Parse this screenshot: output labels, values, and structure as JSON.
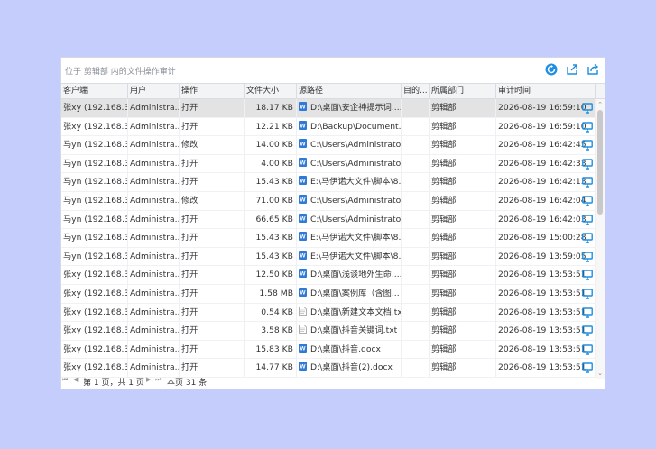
{
  "panel": {
    "title": "位于 剪辑部 内的文件操作审计",
    "icons": [
      "refresh-icon",
      "export-icon",
      "share-icon"
    ],
    "accent_color": "#1e8fe0"
  },
  "columns": [
    "客户端",
    "用户",
    "操作",
    "文件大小",
    "源路径",
    "目的...",
    "所属部门",
    "审计时间"
  ],
  "rows": [
    {
      "client": "张xy (192.168.3...",
      "user": "Administra...",
      "op": "打开",
      "size": "18.17 KB",
      "icon": "word",
      "path": "D:\\桌面\\安企神提示词....",
      "dest": "",
      "dept": "剪辑部",
      "time": "2026-08-19 16:59:10"
    },
    {
      "client": "张xy (192.168.3...",
      "user": "Administra...",
      "op": "打开",
      "size": "12.21 KB",
      "icon": "word",
      "path": "D:\\Backup\\Document...",
      "dest": "",
      "dept": "剪辑部",
      "time": "2026-08-19 16:59:10"
    },
    {
      "client": "马yn (192.168.3...",
      "user": "Administra...",
      "op": "修改",
      "size": "14.00 KB",
      "icon": "word",
      "path": "C:\\Users\\Administrato...",
      "dest": "",
      "dept": "剪辑部",
      "time": "2026-08-19 16:42:45"
    },
    {
      "client": "马yn (192.168.3...",
      "user": "Administra...",
      "op": "打开",
      "size": "4.00 KB",
      "icon": "word",
      "path": "C:\\Users\\Administrato...",
      "dest": "",
      "dept": "剪辑部",
      "time": "2026-08-19 16:42:33"
    },
    {
      "client": "马yn (192.168.3...",
      "user": "Administra...",
      "op": "打开",
      "size": "15.43 KB",
      "icon": "word",
      "path": "E:\\马伊诺大文件\\脚本\\8...",
      "dest": "",
      "dept": "剪辑部",
      "time": "2026-08-19 16:42:13"
    },
    {
      "client": "马yn (192.168.3...",
      "user": "Administra...",
      "op": "修改",
      "size": "71.00 KB",
      "icon": "word",
      "path": "C:\\Users\\Administrato...",
      "dest": "",
      "dept": "剪辑部",
      "time": "2026-08-19 16:42:04"
    },
    {
      "client": "马yn (192.168.3...",
      "user": "Administra...",
      "op": "打开",
      "size": "66.65 KB",
      "icon": "word",
      "path": "C:\\Users\\Administrato...",
      "dest": "",
      "dept": "剪辑部",
      "time": "2026-08-19 16:42:03"
    },
    {
      "client": "马yn (192.168.3...",
      "user": "Administra...",
      "op": "打开",
      "size": "15.43 KB",
      "icon": "word",
      "path": "E:\\马伊诺大文件\\脚本\\8...",
      "dest": "",
      "dept": "剪辑部",
      "time": "2026-08-19 15:00:28"
    },
    {
      "client": "马yn (192.168.3...",
      "user": "Administra...",
      "op": "打开",
      "size": "15.43 KB",
      "icon": "word",
      "path": "E:\\马伊诺大文件\\脚本\\8...",
      "dest": "",
      "dept": "剪辑部",
      "time": "2026-08-19 13:59:05"
    },
    {
      "client": "张xy (192.168.3...",
      "user": "Administra...",
      "op": "打开",
      "size": "12.50 KB",
      "icon": "word",
      "path": "D:\\桌面\\浅谈地外生命....",
      "dest": "",
      "dept": "剪辑部",
      "time": "2026-08-19 13:53:51"
    },
    {
      "client": "张xy (192.168.3...",
      "user": "Administra...",
      "op": "打开",
      "size": "1.58 MB",
      "icon": "word",
      "path": "D:\\桌面\\案例库（含图...",
      "dest": "",
      "dept": "剪辑部",
      "time": "2026-08-19 13:53:51"
    },
    {
      "client": "张xy (192.168.3...",
      "user": "Administra...",
      "op": "打开",
      "size": "0.54 KB",
      "icon": "txt",
      "path": "D:\\桌面\\新建文本文档.txt",
      "dest": "",
      "dept": "剪辑部",
      "time": "2026-08-19 13:53:51"
    },
    {
      "client": "张xy (192.168.3...",
      "user": "Administra...",
      "op": "打开",
      "size": "3.58 KB",
      "icon": "txt",
      "path": "D:\\桌面\\抖音关键词.txt",
      "dest": "",
      "dept": "剪辑部",
      "time": "2026-08-19 13:53:51"
    },
    {
      "client": "张xy (192.168.3...",
      "user": "Administra...",
      "op": "打开",
      "size": "15.83 KB",
      "icon": "word",
      "path": "D:\\桌面\\抖音.docx",
      "dest": "",
      "dept": "剪辑部",
      "time": "2026-08-19 13:53:51"
    },
    {
      "client": "张xy (192.168.3...",
      "user": "Administra...",
      "op": "打开",
      "size": "14.77 KB",
      "icon": "word",
      "path": "D:\\桌面\\抖音(2).docx",
      "dest": "",
      "dept": "剪辑部",
      "time": "2026-08-19 13:53:51"
    }
  ],
  "selected_row": 0,
  "pager": {
    "first": "⏮",
    "prev": "◀",
    "page_text": "第 1 页，共 1 页",
    "next": "▶",
    "last": "⏭",
    "count_text": "本页 31 条"
  }
}
